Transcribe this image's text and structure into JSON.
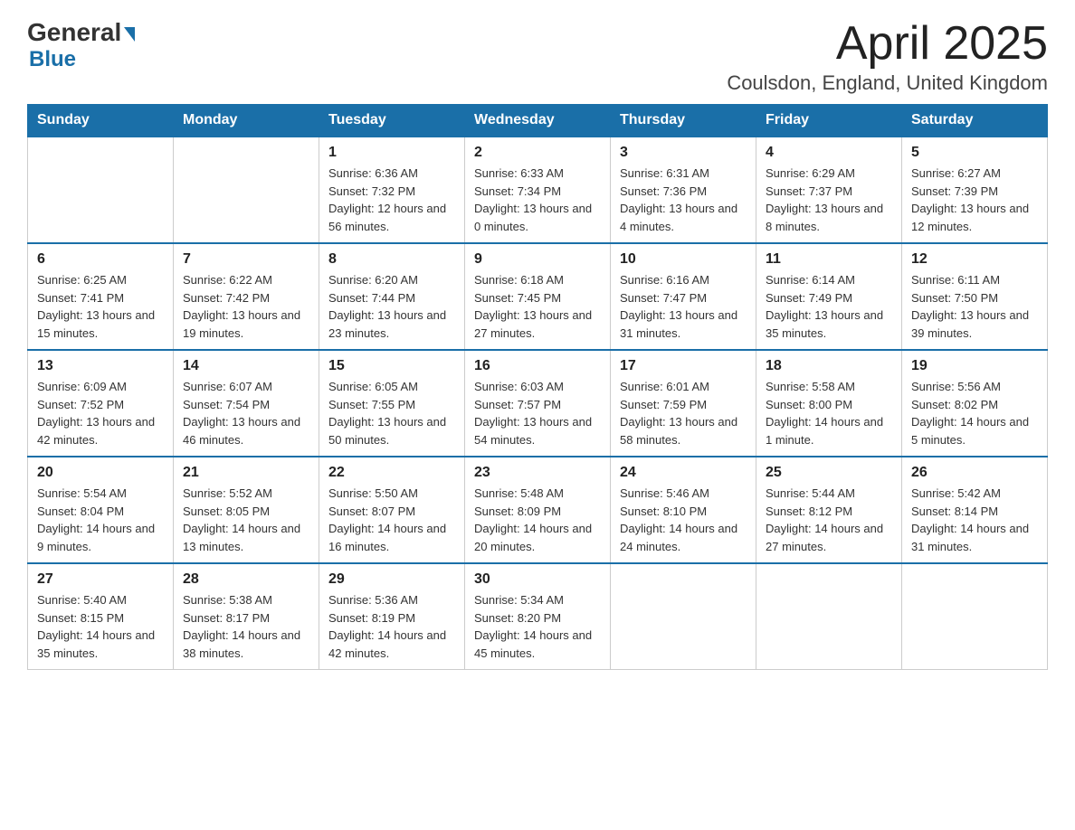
{
  "header": {
    "logo_general": "General",
    "logo_blue": "Blue",
    "month_title": "April 2025",
    "location": "Coulsdon, England, United Kingdom"
  },
  "weekdays": [
    "Sunday",
    "Monday",
    "Tuesday",
    "Wednesday",
    "Thursday",
    "Friday",
    "Saturday"
  ],
  "weeks": [
    [
      {
        "day": "",
        "sunrise": "",
        "sunset": "",
        "daylight": ""
      },
      {
        "day": "",
        "sunrise": "",
        "sunset": "",
        "daylight": ""
      },
      {
        "day": "1",
        "sunrise": "Sunrise: 6:36 AM",
        "sunset": "Sunset: 7:32 PM",
        "daylight": "Daylight: 12 hours and 56 minutes."
      },
      {
        "day": "2",
        "sunrise": "Sunrise: 6:33 AM",
        "sunset": "Sunset: 7:34 PM",
        "daylight": "Daylight: 13 hours and 0 minutes."
      },
      {
        "day": "3",
        "sunrise": "Sunrise: 6:31 AM",
        "sunset": "Sunset: 7:36 PM",
        "daylight": "Daylight: 13 hours and 4 minutes."
      },
      {
        "day": "4",
        "sunrise": "Sunrise: 6:29 AM",
        "sunset": "Sunset: 7:37 PM",
        "daylight": "Daylight: 13 hours and 8 minutes."
      },
      {
        "day": "5",
        "sunrise": "Sunrise: 6:27 AM",
        "sunset": "Sunset: 7:39 PM",
        "daylight": "Daylight: 13 hours and 12 minutes."
      }
    ],
    [
      {
        "day": "6",
        "sunrise": "Sunrise: 6:25 AM",
        "sunset": "Sunset: 7:41 PM",
        "daylight": "Daylight: 13 hours and 15 minutes."
      },
      {
        "day": "7",
        "sunrise": "Sunrise: 6:22 AM",
        "sunset": "Sunset: 7:42 PM",
        "daylight": "Daylight: 13 hours and 19 minutes."
      },
      {
        "day": "8",
        "sunrise": "Sunrise: 6:20 AM",
        "sunset": "Sunset: 7:44 PM",
        "daylight": "Daylight: 13 hours and 23 minutes."
      },
      {
        "day": "9",
        "sunrise": "Sunrise: 6:18 AM",
        "sunset": "Sunset: 7:45 PM",
        "daylight": "Daylight: 13 hours and 27 minutes."
      },
      {
        "day": "10",
        "sunrise": "Sunrise: 6:16 AM",
        "sunset": "Sunset: 7:47 PM",
        "daylight": "Daylight: 13 hours and 31 minutes."
      },
      {
        "day": "11",
        "sunrise": "Sunrise: 6:14 AM",
        "sunset": "Sunset: 7:49 PM",
        "daylight": "Daylight: 13 hours and 35 minutes."
      },
      {
        "day": "12",
        "sunrise": "Sunrise: 6:11 AM",
        "sunset": "Sunset: 7:50 PM",
        "daylight": "Daylight: 13 hours and 39 minutes."
      }
    ],
    [
      {
        "day": "13",
        "sunrise": "Sunrise: 6:09 AM",
        "sunset": "Sunset: 7:52 PM",
        "daylight": "Daylight: 13 hours and 42 minutes."
      },
      {
        "day": "14",
        "sunrise": "Sunrise: 6:07 AM",
        "sunset": "Sunset: 7:54 PM",
        "daylight": "Daylight: 13 hours and 46 minutes."
      },
      {
        "day": "15",
        "sunrise": "Sunrise: 6:05 AM",
        "sunset": "Sunset: 7:55 PM",
        "daylight": "Daylight: 13 hours and 50 minutes."
      },
      {
        "day": "16",
        "sunrise": "Sunrise: 6:03 AM",
        "sunset": "Sunset: 7:57 PM",
        "daylight": "Daylight: 13 hours and 54 minutes."
      },
      {
        "day": "17",
        "sunrise": "Sunrise: 6:01 AM",
        "sunset": "Sunset: 7:59 PM",
        "daylight": "Daylight: 13 hours and 58 minutes."
      },
      {
        "day": "18",
        "sunrise": "Sunrise: 5:58 AM",
        "sunset": "Sunset: 8:00 PM",
        "daylight": "Daylight: 14 hours and 1 minute."
      },
      {
        "day": "19",
        "sunrise": "Sunrise: 5:56 AM",
        "sunset": "Sunset: 8:02 PM",
        "daylight": "Daylight: 14 hours and 5 minutes."
      }
    ],
    [
      {
        "day": "20",
        "sunrise": "Sunrise: 5:54 AM",
        "sunset": "Sunset: 8:04 PM",
        "daylight": "Daylight: 14 hours and 9 minutes."
      },
      {
        "day": "21",
        "sunrise": "Sunrise: 5:52 AM",
        "sunset": "Sunset: 8:05 PM",
        "daylight": "Daylight: 14 hours and 13 minutes."
      },
      {
        "day": "22",
        "sunrise": "Sunrise: 5:50 AM",
        "sunset": "Sunset: 8:07 PM",
        "daylight": "Daylight: 14 hours and 16 minutes."
      },
      {
        "day": "23",
        "sunrise": "Sunrise: 5:48 AM",
        "sunset": "Sunset: 8:09 PM",
        "daylight": "Daylight: 14 hours and 20 minutes."
      },
      {
        "day": "24",
        "sunrise": "Sunrise: 5:46 AM",
        "sunset": "Sunset: 8:10 PM",
        "daylight": "Daylight: 14 hours and 24 minutes."
      },
      {
        "day": "25",
        "sunrise": "Sunrise: 5:44 AM",
        "sunset": "Sunset: 8:12 PM",
        "daylight": "Daylight: 14 hours and 27 minutes."
      },
      {
        "day": "26",
        "sunrise": "Sunrise: 5:42 AM",
        "sunset": "Sunset: 8:14 PM",
        "daylight": "Daylight: 14 hours and 31 minutes."
      }
    ],
    [
      {
        "day": "27",
        "sunrise": "Sunrise: 5:40 AM",
        "sunset": "Sunset: 8:15 PM",
        "daylight": "Daylight: 14 hours and 35 minutes."
      },
      {
        "day": "28",
        "sunrise": "Sunrise: 5:38 AM",
        "sunset": "Sunset: 8:17 PM",
        "daylight": "Daylight: 14 hours and 38 minutes."
      },
      {
        "day": "29",
        "sunrise": "Sunrise: 5:36 AM",
        "sunset": "Sunset: 8:19 PM",
        "daylight": "Daylight: 14 hours and 42 minutes."
      },
      {
        "day": "30",
        "sunrise": "Sunrise: 5:34 AM",
        "sunset": "Sunset: 8:20 PM",
        "daylight": "Daylight: 14 hours and 45 minutes."
      },
      {
        "day": "",
        "sunrise": "",
        "sunset": "",
        "daylight": ""
      },
      {
        "day": "",
        "sunrise": "",
        "sunset": "",
        "daylight": ""
      },
      {
        "day": "",
        "sunrise": "",
        "sunset": "",
        "daylight": ""
      }
    ]
  ]
}
